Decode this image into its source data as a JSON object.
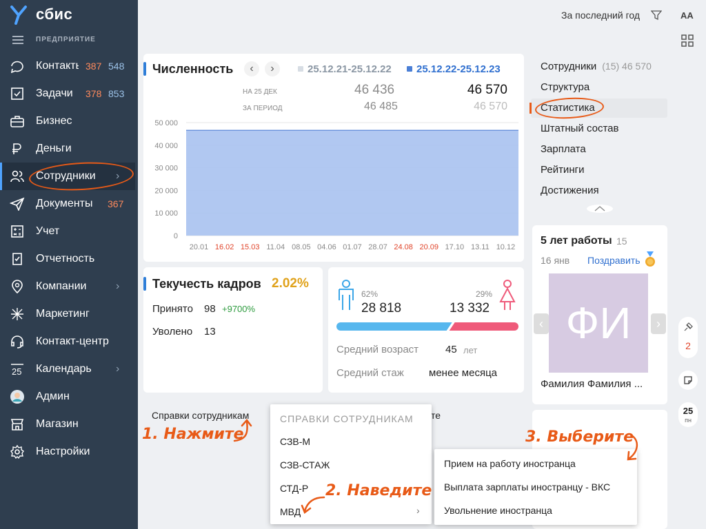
{
  "brand": {
    "name": "сбис",
    "company": "ПРЕДПРИЯТИЕ"
  },
  "nav": [
    {
      "label": "Контакты",
      "c1": "387",
      "c2": "548",
      "icon": "chat-icon"
    },
    {
      "label": "Задачи",
      "c1": "378",
      "c2": "853",
      "icon": "tasks-icon"
    },
    {
      "label": "Бизнес",
      "icon": "briefcase-icon"
    },
    {
      "label": "Деньги",
      "icon": "money-icon"
    },
    {
      "label": "Сотрудники",
      "icon": "people-icon",
      "active": true,
      "chev": true
    },
    {
      "label": "Документы",
      "c1": "367",
      "icon": "send-icon"
    },
    {
      "label": "Учет",
      "icon": "calculator-icon"
    },
    {
      "label": "Отчетность",
      "icon": "report-icon"
    },
    {
      "label": "Компании",
      "icon": "location-icon",
      "chev": true
    },
    {
      "label": "Маркетинг",
      "icon": "sparkle-icon"
    },
    {
      "label": "Контакт-центр",
      "icon": "headset-icon"
    },
    {
      "label": "Календарь",
      "icon": "calendar-icon",
      "chev": true,
      "icon_text": "25"
    },
    {
      "label": "Админ",
      "icon": "avatar-icon"
    },
    {
      "label": "Магазин",
      "icon": "shop-icon"
    },
    {
      "label": "Настройки",
      "icon": "gear-icon"
    }
  ],
  "header": {
    "period": "За последний год",
    "font_btn": "AA"
  },
  "headcount": {
    "title": "Численность",
    "range1": "25.12.21-25.12.22",
    "range2": "25.12.22-25.12.23",
    "row1_label": "НА 25 ДЕК",
    "row1_v1": "46 436",
    "row1_v2": "46 570",
    "row2_label": "ЗА ПЕРИОД",
    "row2_v1": "46 485",
    "row2_v2": "46 570"
  },
  "chart_data": {
    "type": "area",
    "categories": [
      "20.01",
      "16.02",
      "15.03",
      "11.04",
      "08.05",
      "04.06",
      "01.07",
      "28.07",
      "24.08",
      "20.09",
      "17.10",
      "13.11",
      "10.12"
    ],
    "red_ticks": [
      "16.02",
      "15.03",
      "24.08",
      "20.09"
    ],
    "values": [
      46570,
      46570,
      46570,
      46570,
      46570,
      46570,
      46570,
      46570,
      46570,
      46570,
      46570,
      46570,
      46570
    ],
    "y_ticks": [
      "50 000",
      "40 000",
      "30 000",
      "20 000",
      "10 000",
      "0"
    ],
    "ylim": [
      0,
      50000
    ],
    "grid": true,
    "color": "#a9c2f0"
  },
  "turnover": {
    "title": "Текучесть кадров",
    "pct": "2.02%",
    "hired_label": "Принято",
    "hired": "98",
    "hired_delta": "+9700%",
    "fired_label": "Уволено",
    "fired": "13"
  },
  "gender": {
    "male_pct": "62%",
    "male": "28 818",
    "female_pct": "29%",
    "female": "13 332",
    "male_share": 0.62,
    "age_label": "Средний возраст",
    "age": "45",
    "age_unit": "лет",
    "tenure_label": "Средний стаж",
    "tenure": "менее месяца"
  },
  "right_menu": [
    {
      "label": "Сотрудники",
      "extra": "(15) 46 570"
    },
    {
      "label": "Структура"
    },
    {
      "label": "Статистика",
      "active": true
    },
    {
      "label": "Штатный состав"
    },
    {
      "label": "Зарплата"
    },
    {
      "label": "Рейтинги"
    },
    {
      "label": "Достижения"
    }
  ],
  "anniv": {
    "title": "5 лет работы",
    "count": "15",
    "date": "16 янв",
    "congrat": "Поздравить",
    "initials": "ФИ",
    "name": "Фамилия Фамилия ..."
  },
  "side_widgets": {
    "count": "2",
    "day": "25",
    "weekday": "пн"
  },
  "bottom": {
    "certs": "Справки сотрудникам",
    "cut_tail": "те"
  },
  "popup1": {
    "title": "СПРАВКИ СОТРУДНИКАМ",
    "items": [
      "СЗВ-М",
      "СЗВ-СТАЖ",
      "СТД-Р",
      "МВД"
    ]
  },
  "popup2": {
    "items": [
      "Прием на работу иностранца",
      "Выплата зарплаты иностранцу - ВКС",
      "Увольнение иностранца"
    ]
  },
  "hints": {
    "h1": "1. Нажмите",
    "h2": "2. Наведите",
    "h3": "3. Выберите"
  }
}
